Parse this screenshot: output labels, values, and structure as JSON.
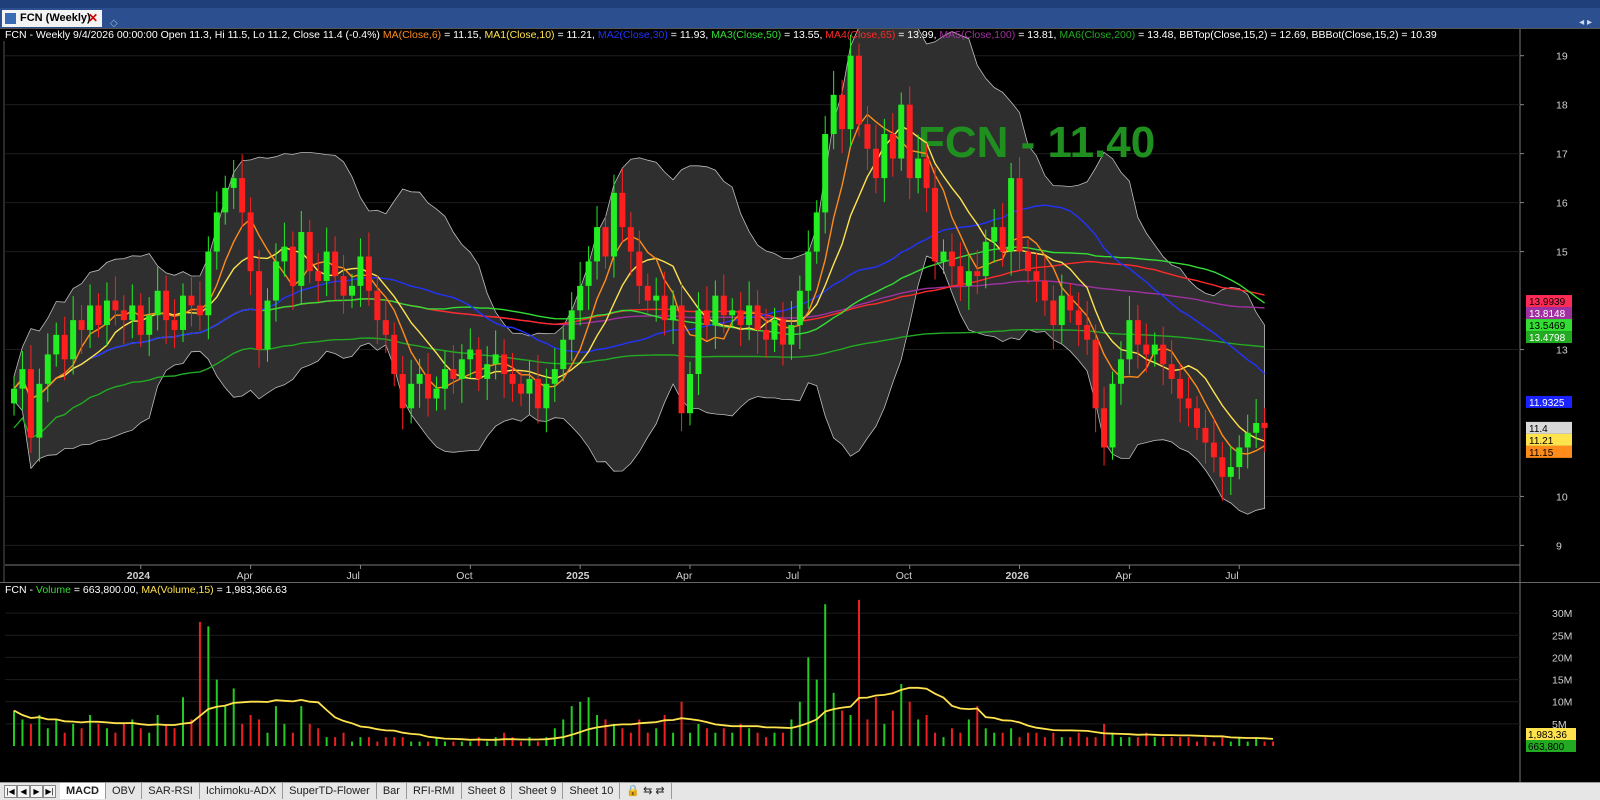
{
  "window": {
    "tab_label": "FCN (Weekly)",
    "close_symbol": "✕",
    "newtab_symbol": "◇",
    "winctl": "◂ ▸"
  },
  "price_legend": [
    {
      "text": "FCN - Weekly 9/4/2026 00:00:00 Open 11.3, Hi 11.5, Lo 11.2, Close 11.4 (-0.4%) ",
      "color": "#ffffff"
    },
    {
      "text": "MA(Close,6)",
      "color": "#ff8c1a"
    },
    {
      "text": " = 11.15, ",
      "color": "#ffffff"
    },
    {
      "text": "MA1(Close,10)",
      "color": "#ffe34d"
    },
    {
      "text": " = 11.21, ",
      "color": "#ffffff"
    },
    {
      "text": "MA2(Close,30)",
      "color": "#2233ff"
    },
    {
      "text": " = 11.93, ",
      "color": "#ffffff"
    },
    {
      "text": "MA3(Close,50)",
      "color": "#33dd33"
    },
    {
      "text": " = 13.55, ",
      "color": "#ffffff"
    },
    {
      "text": "MA4(Close,65)",
      "color": "#ff2a2a"
    },
    {
      "text": " = 13.99, ",
      "color": "#ffffff"
    },
    {
      "text": "MA5(Close,100)",
      "color": "#a030a0"
    },
    {
      "text": " = 13.81, ",
      "color": "#ffffff"
    },
    {
      "text": "MA6(Close,200)",
      "color": "#22aa22"
    },
    {
      "text": " = 13.48, BBTop(Close,15,2) = 12.69, BBBot(Close,15,2) = 10.39",
      "color": "#ffffff"
    }
  ],
  "volume_legend": [
    {
      "text": "FCN - ",
      "color": "#ffffff"
    },
    {
      "text": "Volume",
      "color": "#33dd33"
    },
    {
      "text": " = 663,800.00, ",
      "color": "#ffffff"
    },
    {
      "text": "MA(Volume,15)",
      "color": "#ffe34d"
    },
    {
      "text": " = 1,983,366.63",
      "color": "#ffffff"
    }
  ],
  "watermark": {
    "text": "FCN - 11.40",
    "color": "#1f8f1f"
  },
  "price_axis_labels": [
    "19",
    "18",
    "17",
    "16",
    "15",
    "13",
    "10",
    "9"
  ],
  "price_axis_boxes": [
    {
      "label": "13.9939",
      "value": 13.99,
      "color": "#ff2a55",
      "text_color": "#000000"
    },
    {
      "label": "13.8148",
      "value": 13.81,
      "color": "#a030a0",
      "text_color": "#ffffff"
    },
    {
      "label": "13.5469",
      "value": 13.55,
      "color": "#33dd33",
      "text_color": "#000000"
    },
    {
      "label": "13.4798",
      "value": 13.48,
      "color": "#22aa22",
      "text_color": "#ffffff"
    },
    {
      "label": "11.9325",
      "value": 11.93,
      "color": "#1a22ff",
      "text_color": "#ffffff"
    },
    {
      "label": "11.4",
      "value": 11.4,
      "color": "#d8d8d8",
      "text_color": "#000000"
    },
    {
      "label": "11.21",
      "value": 11.21,
      "color": "#ffe34d",
      "text_color": "#000000"
    },
    {
      "label": "11.15",
      "value": 11.15,
      "color": "#ff8c1a",
      "text_color": "#000000"
    }
  ],
  "volume_axis_labels": [
    "30M",
    "25M",
    "20M",
    "15M",
    "10M",
    "5M"
  ],
  "volume_axis_boxes": [
    {
      "label": "1,983,36",
      "color": "#ffe34d",
      "text_color": "#000000"
    },
    {
      "label": "663,800",
      "color": "#22aa22",
      "text_color": "#000000"
    }
  ],
  "time_axis": [
    {
      "label": "2024",
      "week": 15,
      "bold": true
    },
    {
      "label": "Apr",
      "week": 28,
      "bold": false
    },
    {
      "label": "Jul",
      "week": 41,
      "bold": false
    },
    {
      "label": "Oct",
      "week": 54,
      "bold": false
    },
    {
      "label": "2025",
      "week": 67,
      "bold": true
    },
    {
      "label": "Apr",
      "week": 80,
      "bold": false
    },
    {
      "label": "Jul",
      "week": 93,
      "bold": false
    },
    {
      "label": "Oct",
      "week": 106,
      "bold": false
    },
    {
      "label": "2026",
      "week": 119,
      "bold": true
    },
    {
      "label": "Apr",
      "week": 132,
      "bold": false
    },
    {
      "label": "Jul",
      "week": 145,
      "bold": false
    }
  ],
  "sheet_tabs": [
    "MACD",
    "OBV",
    "SAR-RSI",
    "Ichimoku-ADX",
    "SuperTD-Flower",
    "Bar",
    "RFI-RMI",
    "Sheet 8",
    "Sheet 9",
    "Sheet 10"
  ],
  "nav_symbols": [
    "|◀",
    "◀",
    "▶",
    "▶|"
  ],
  "icons": {
    "lock": "lock-icon",
    "sheet_add": "sheet-add-icon"
  },
  "chart_data": {
    "type": "candlestick",
    "ticker": "FCN",
    "period": "Weekly",
    "y_range": [
      8.6,
      19.3
    ],
    "volume_range_millions": [
      0,
      35
    ],
    "closes": [
      12.2,
      12.6,
      11.2,
      12.3,
      12.9,
      13.3,
      12.8,
      13.6,
      13.4,
      13.9,
      13.5,
      14.0,
      13.8,
      13.6,
      13.9,
      13.3,
      13.7,
      14.2,
      13.6,
      13.4,
      14.1,
      13.9,
      13.7,
      15.0,
      15.8,
      16.3,
      16.5,
      15.8,
      14.6,
      13.0,
      14.0,
      14.8,
      15.1,
      14.3,
      15.4,
      14.6,
      14.4,
      15.0,
      14.5,
      14.1,
      14.3,
      14.9,
      14.2,
      13.6,
      13.3,
      12.5,
      11.8,
      12.3,
      12.5,
      12.0,
      12.2,
      12.6,
      12.4,
      12.8,
      13.0,
      12.4,
      12.7,
      12.9,
      12.5,
      12.3,
      12.1,
      12.4,
      11.8,
      12.3,
      12.6,
      13.2,
      13.8,
      14.3,
      14.8,
      15.5,
      14.9,
      16.2,
      15.5,
      15.0,
      14.3,
      14.0,
      14.1,
      13.6,
      13.9,
      11.7,
      12.5,
      13.8,
      13.5,
      14.1,
      13.7,
      13.8,
      13.5,
      13.9,
      13.4,
      13.2,
      13.6,
      13.1,
      13.5,
      14.2,
      15.0,
      15.8,
      17.4,
      18.2,
      17.5,
      19.0,
      17.6,
      17.1,
      16.5,
      17.4,
      16.9,
      18.0,
      16.5,
      16.9,
      16.3,
      14.8,
      15.0,
      14.7,
      14.3,
      14.6,
      14.5,
      15.2,
      15.5,
      15.0,
      16.5,
      15.0,
      14.6,
      14.4,
      14.0,
      13.5,
      14.1,
      13.8,
      13.5,
      13.2,
      11.8,
      11.0,
      12.3,
      12.8,
      13.6,
      13.1,
      12.9,
      13.1,
      12.7,
      12.4,
      12.0,
      11.8,
      11.4,
      11.1,
      10.8,
      10.4,
      10.6,
      11.0,
      11.3,
      11.5,
      11.4
    ],
    "volumes_millions": [
      8,
      6,
      5,
      7,
      4,
      6,
      3,
      5,
      4,
      7,
      5,
      4,
      3,
      5,
      6,
      4,
      3,
      7,
      5,
      4,
      11,
      6,
      28,
      27,
      15,
      9,
      13,
      5,
      7,
      6,
      3,
      9,
      5,
      3,
      9,
      5,
      4,
      2,
      2,
      3,
      1,
      2,
      2,
      1,
      2,
      2,
      2,
      1,
      1,
      1,
      2,
      1,
      1,
      1,
      1,
      2,
      1,
      2,
      3,
      2,
      1,
      2,
      1,
      2,
      4,
      6,
      9,
      10,
      11,
      7,
      6,
      5,
      4,
      3,
      6,
      3,
      4,
      7,
      3,
      10,
      3,
      5,
      4,
      3,
      4,
      3,
      5,
      4,
      3,
      2,
      3,
      3,
      6,
      10,
      20,
      15,
      32,
      12,
      8,
      7,
      33,
      6,
      11,
      5,
      8,
      14,
      10,
      6,
      7,
      3,
      2,
      4,
      3,
      6,
      9,
      4,
      3,
      3,
      4,
      2,
      3,
      3,
      2,
      3,
      2,
      2,
      3,
      2,
      2,
      5,
      3,
      2,
      2,
      2,
      3,
      2,
      2,
      2,
      2,
      2,
      1,
      2,
      1,
      2,
      1,
      2,
      1,
      2,
      1,
      1
    ]
  }
}
